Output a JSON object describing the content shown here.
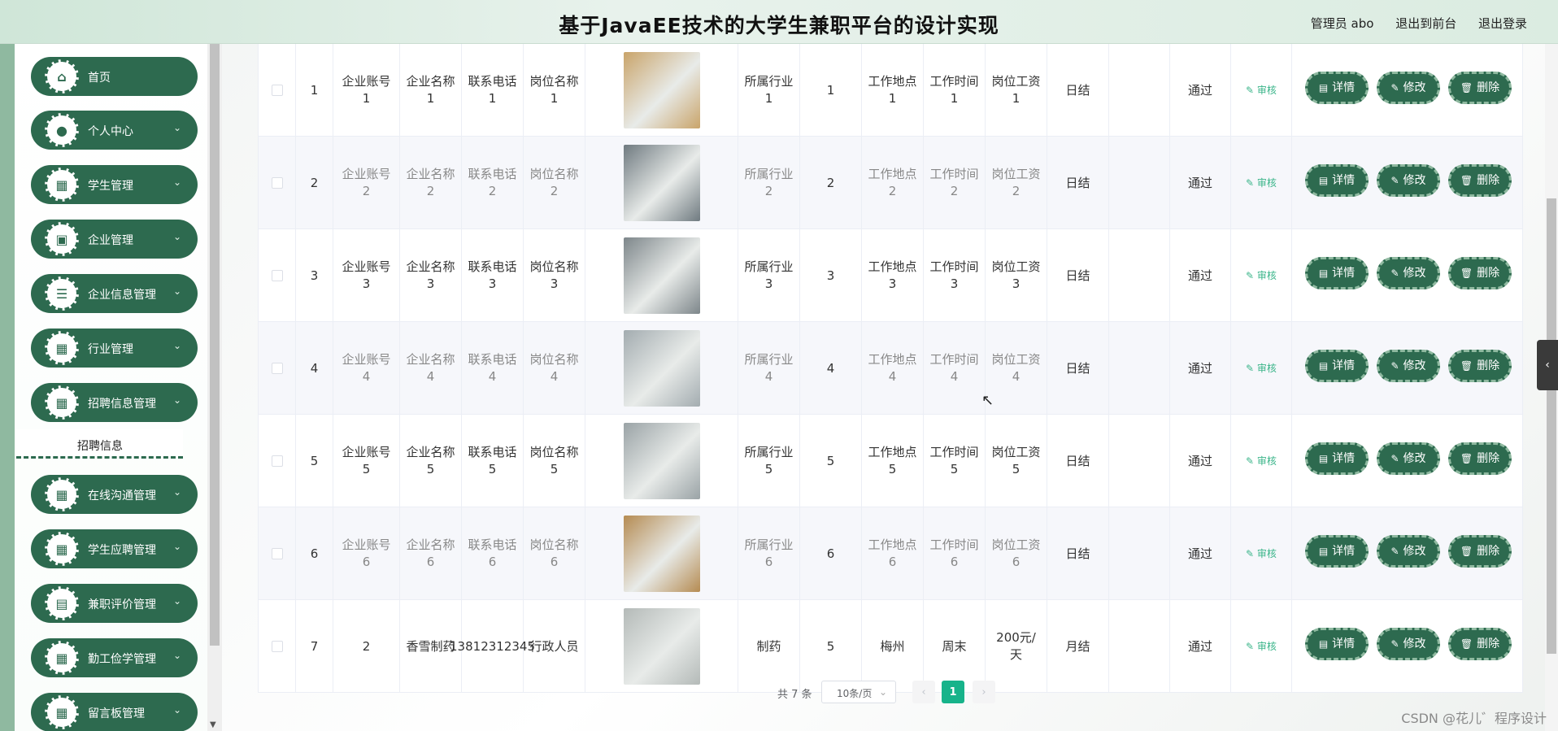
{
  "header": {
    "title": "基于JavaEE技术的大学生兼职平台的设计实现",
    "user": "管理员 abo",
    "to_front": "退出到前台",
    "logout": "退出登录"
  },
  "sidebar": {
    "items": [
      {
        "label": "首页",
        "icon": "home-icon",
        "glyph": "⌂",
        "chevron": false
      },
      {
        "label": "个人中心",
        "icon": "user-icon",
        "glyph": "●",
        "chevron": true
      },
      {
        "label": "学生管理",
        "icon": "grid-icon",
        "glyph": "▦",
        "chevron": true
      },
      {
        "label": "企业管理",
        "icon": "briefcase-icon",
        "glyph": "▣",
        "chevron": true
      },
      {
        "label": "企业信息管理",
        "icon": "list-icon",
        "glyph": "☰",
        "chevron": true
      },
      {
        "label": "行业管理",
        "icon": "apps-icon",
        "glyph": "▦",
        "chevron": true
      },
      {
        "label": "招聘信息管理",
        "icon": "grid-icon",
        "glyph": "▦",
        "chevron": true
      },
      {
        "label": "在线沟通管理",
        "icon": "grid-icon",
        "glyph": "▦",
        "chevron": true
      },
      {
        "label": "学生应聘管理",
        "icon": "grid-icon",
        "glyph": "▦",
        "chevron": true
      },
      {
        "label": "兼职评价管理",
        "icon": "clipboard-icon",
        "glyph": "▤",
        "chevron": true
      },
      {
        "label": "勤工俭学管理",
        "icon": "grid-icon",
        "glyph": "▦",
        "chevron": true
      },
      {
        "label": "留言板管理",
        "icon": "grid-icon",
        "glyph": "▦",
        "chevron": true
      }
    ],
    "submenu_label": "招聘信息"
  },
  "table": {
    "rows": [
      {
        "no": "1",
        "account": "企业账号1",
        "name": "企业名称1",
        "phone": "联系电话1",
        "position": "岗位名称1",
        "industry": "所属行业1",
        "count": "1",
        "location": "工作地点1",
        "time": "工作时间1",
        "salary": "岗位工资1",
        "settle": "日结",
        "extra": "",
        "status": "通过",
        "audit": "审核",
        "img": "#c9a46a"
      },
      {
        "no": "2",
        "account": "企业账号2",
        "name": "企业名称2",
        "phone": "联系电话2",
        "position": "岗位名称2",
        "industry": "所属行业2",
        "count": "2",
        "location": "工作地点2",
        "time": "工作时间2",
        "salary": "岗位工资2",
        "settle": "日结",
        "extra": "",
        "status": "通过",
        "audit": "审核",
        "img": "#6f7a80"
      },
      {
        "no": "3",
        "account": "企业账号3",
        "name": "企业名称3",
        "phone": "联系电话3",
        "position": "岗位名称3",
        "industry": "所属行业3",
        "count": "3",
        "location": "工作地点3",
        "time": "工作时间3",
        "salary": "岗位工资3",
        "settle": "日结",
        "extra": "",
        "status": "通过",
        "audit": "审核",
        "img": "#7d868a"
      },
      {
        "no": "4",
        "account": "企业账号4",
        "name": "企业名称4",
        "phone": "联系电话4",
        "position": "岗位名称4",
        "industry": "所属行业4",
        "count": "4",
        "location": "工作地点4",
        "time": "工作时间4",
        "salary": "岗位工资4",
        "settle": "日结",
        "extra": "",
        "status": "通过",
        "audit": "审核",
        "img": "#a3acb0"
      },
      {
        "no": "5",
        "account": "企业账号5",
        "name": "企业名称5",
        "phone": "联系电话5",
        "position": "岗位名称5",
        "industry": "所属行业5",
        "count": "5",
        "location": "工作地点5",
        "time": "工作时间5",
        "salary": "岗位工资5",
        "settle": "日结",
        "extra": "",
        "status": "通过",
        "audit": "审核",
        "img": "#9aa3a6"
      },
      {
        "no": "6",
        "account": "企业账号6",
        "name": "企业名称6",
        "phone": "联系电话6",
        "position": "岗位名称6",
        "industry": "所属行业6",
        "count": "6",
        "location": "工作地点6",
        "time": "工作时间6",
        "salary": "岗位工资6",
        "settle": "日结",
        "extra": "",
        "status": "通过",
        "audit": "审核",
        "img": "#b58b52"
      },
      {
        "no": "7",
        "account": "2",
        "name": "香雪制药",
        "phone": "13812312345",
        "position": "行政人员",
        "industry": "制药",
        "count": "5",
        "location": "梅州",
        "time": "周末",
        "salary": "200元/天",
        "settle": "月结",
        "extra": "",
        "status": "通过",
        "audit": "审核",
        "img": "#b4bab8"
      }
    ],
    "actions": {
      "detail": "详情",
      "edit": "修改",
      "delete": "删除"
    }
  },
  "pagination": {
    "total": "共 7 条",
    "page_size": "10条/页",
    "current_page": "1",
    "prev": "‹",
    "next": "›"
  },
  "watermark": "CSDN @花儿゛程序设计",
  "colors": {
    "primary": "#2d6a4f",
    "accent": "#17b38a",
    "header_bg": "#dbece1"
  }
}
